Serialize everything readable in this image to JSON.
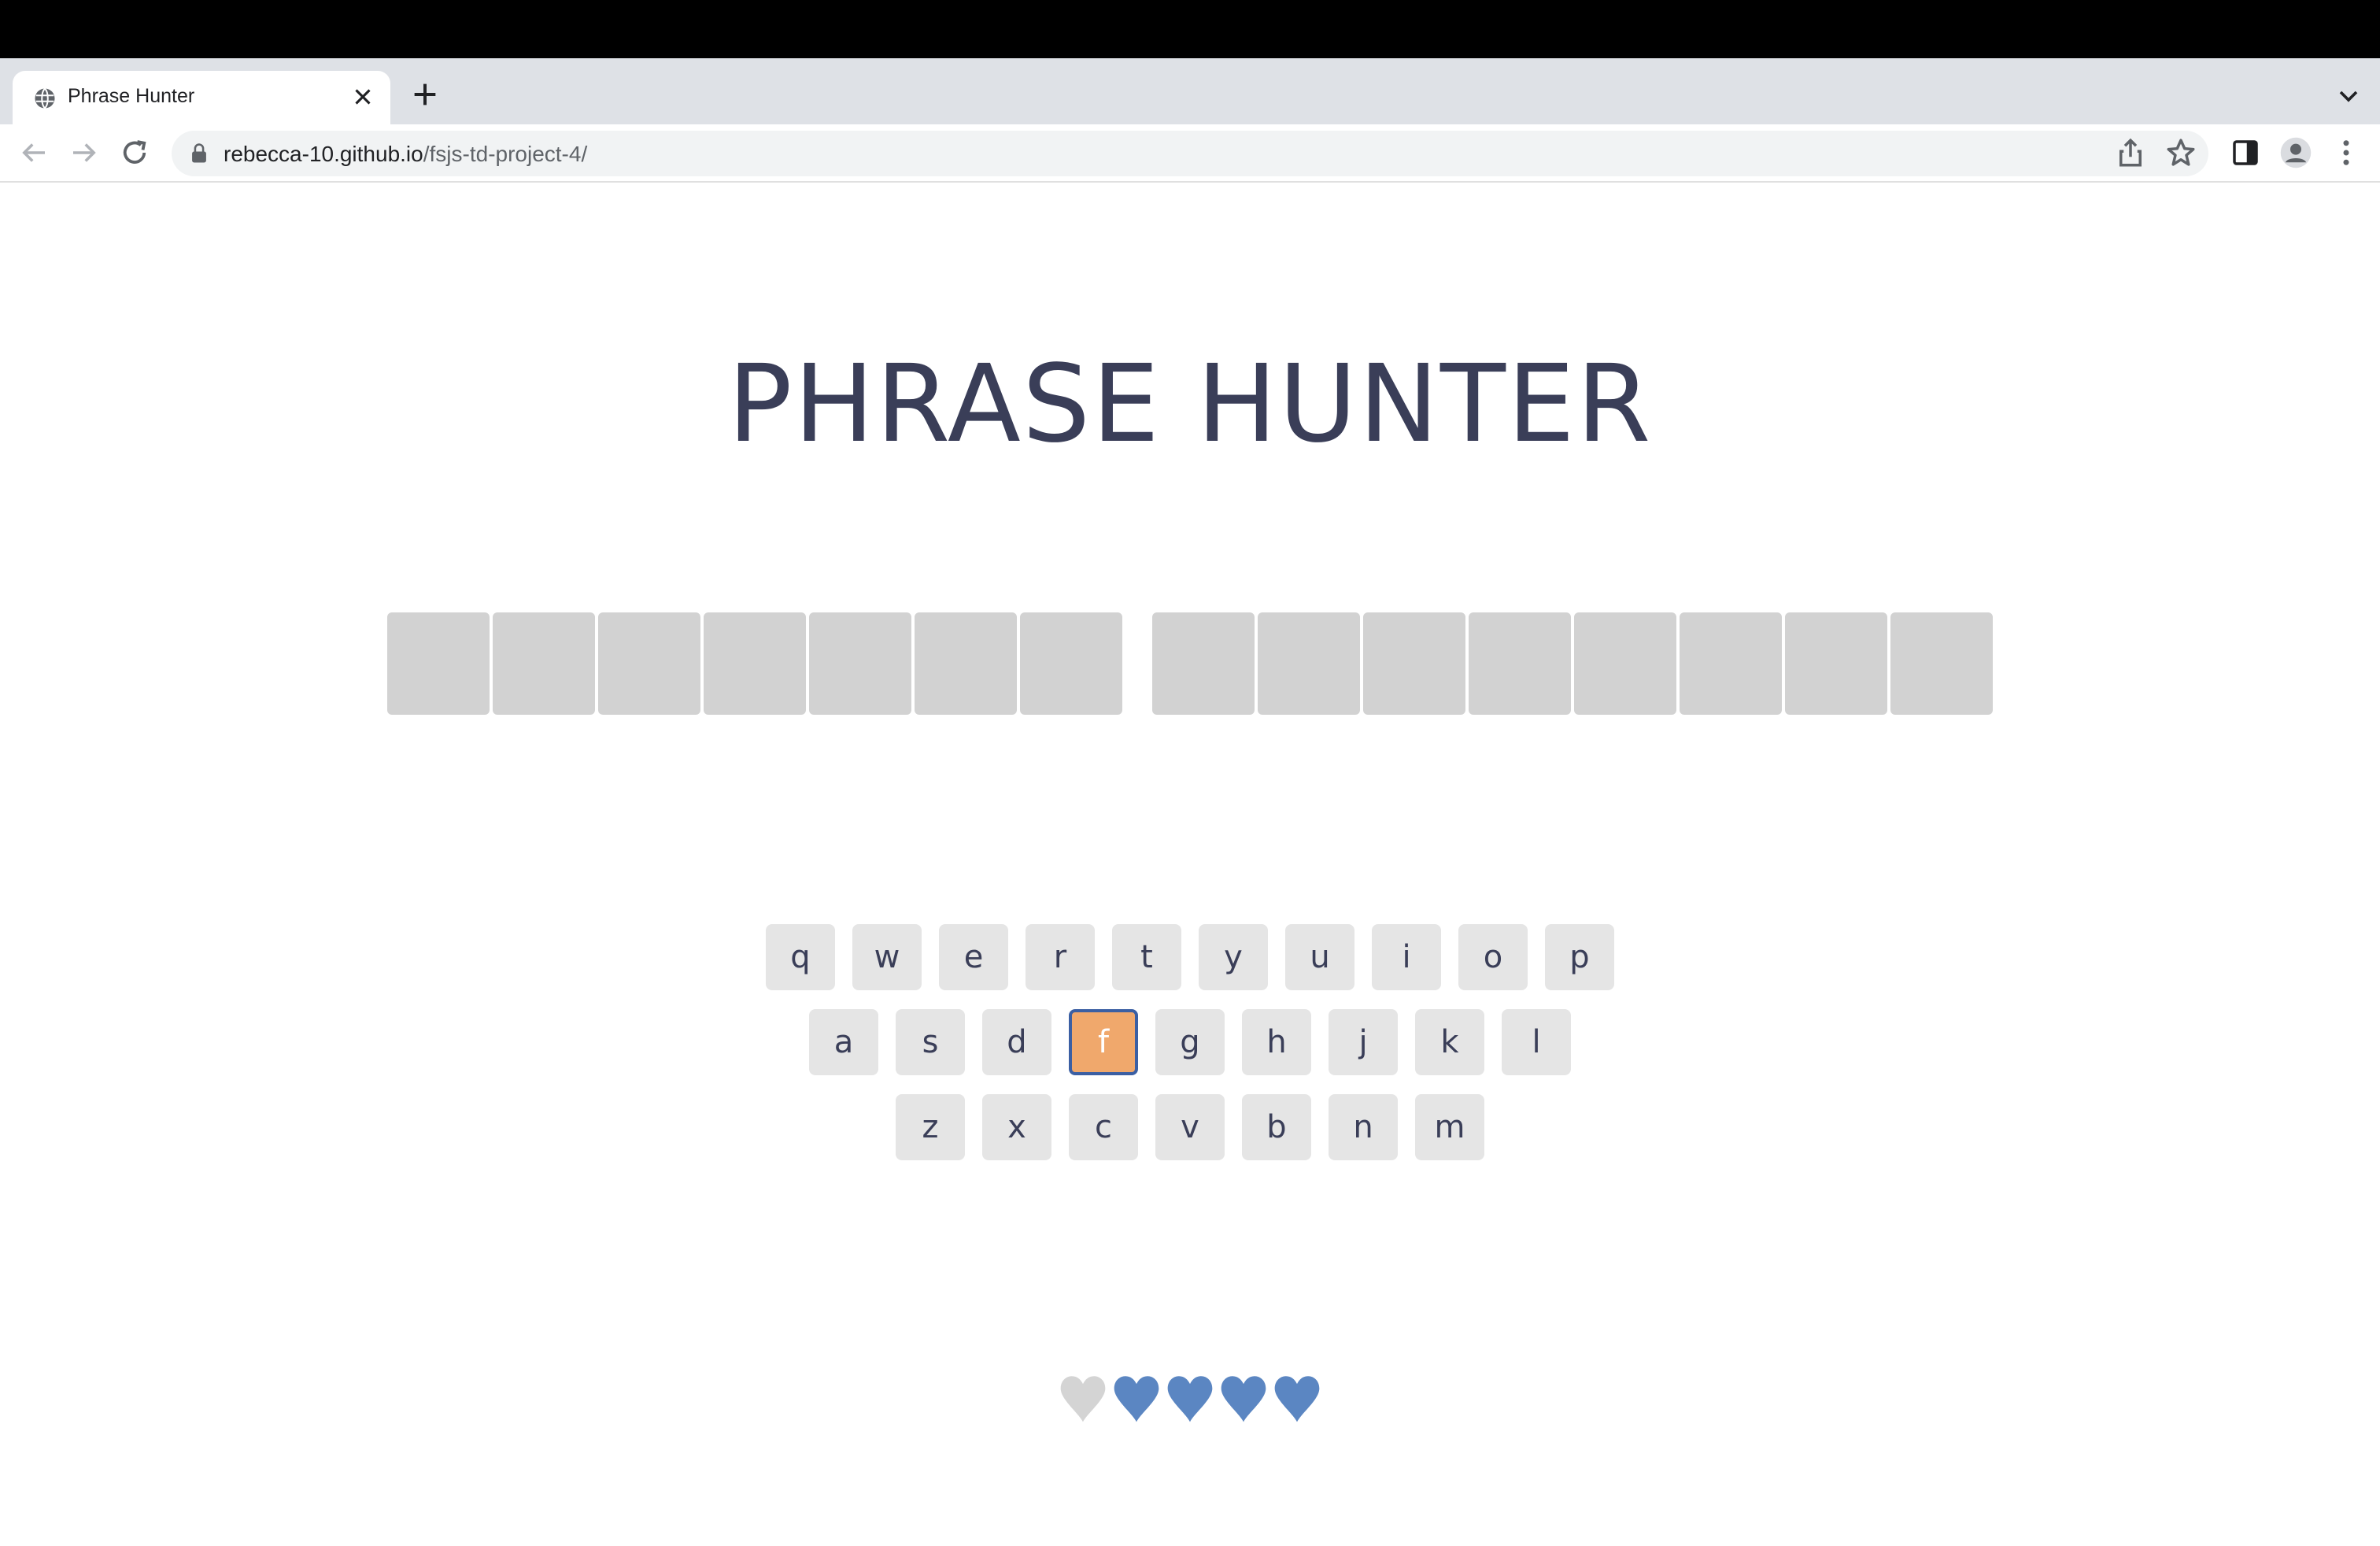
{
  "browser": {
    "tab": {
      "title": "Phrase Hunter",
      "favicon": "globe-icon"
    },
    "url": {
      "host": "rebecca-10.github.io",
      "path": "/fsjs-td-project-4/"
    }
  },
  "page": {
    "title": "PHRASE HUNTER",
    "phrase_words": [
      7,
      8
    ],
    "keyboard": {
      "rows": [
        [
          "q",
          "w",
          "e",
          "r",
          "t",
          "y",
          "u",
          "i",
          "o",
          "p"
        ],
        [
          "a",
          "s",
          "d",
          "f",
          "g",
          "h",
          "j",
          "k",
          "l"
        ],
        [
          "z",
          "x",
          "c",
          "v",
          "b",
          "n",
          "m"
        ]
      ],
      "chosen": [
        "f"
      ]
    },
    "lives": {
      "total": 5,
      "lost": 1
    },
    "colors": {
      "title": "#3a3e58",
      "letter_box": "#d2d2d2",
      "key": "#e5e5e5",
      "key_chosen": "#f0a86c",
      "key_chosen_border": "#3b5fa3",
      "heart_live": "#5b86c2",
      "heart_lost": "#d4d4d4"
    }
  }
}
